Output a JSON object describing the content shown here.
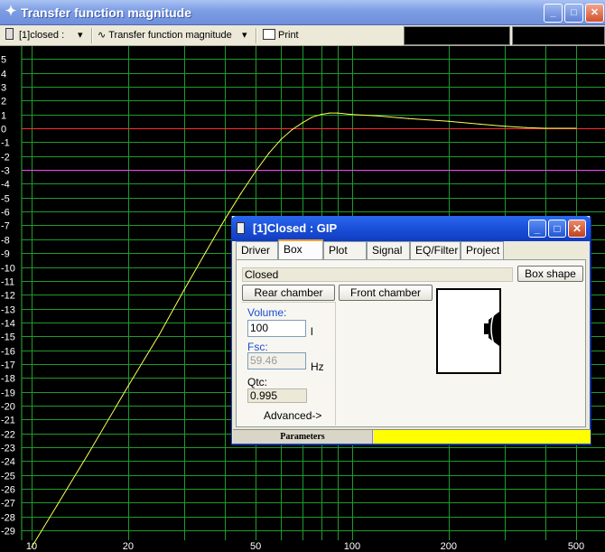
{
  "window": {
    "title": "Transfer function magnitude",
    "minimize_glyph": "_",
    "maximize_glyph": "□",
    "close_glyph": "✕"
  },
  "toolbar": {
    "project_select": "[1]closed :",
    "graph_select": "Transfer function magnitude",
    "print_label": "Print",
    "icons": [
      "speaker-icon",
      "waveform-icon",
      "printer-icon"
    ]
  },
  "plot": {
    "background": "#000000",
    "grid_color": "#1f9a2a",
    "curve_color": "#ffff55",
    "ref_line_0db_color": "#ff3030",
    "ref_line_minus3db_color": "#ff40ff",
    "y_ticks": [
      "5",
      "4",
      "3",
      "2",
      "1",
      "0",
      "-1",
      "-2",
      "-3",
      "-4",
      "-5",
      "-6",
      "-7",
      "-8",
      "-9",
      "-10",
      "-11",
      "-12",
      "-13",
      "-14",
      "-15",
      "-16",
      "-17",
      "-18",
      "-19",
      "-20",
      "-21",
      "-22",
      "-23",
      "-24",
      "-25",
      "-26",
      "-27",
      "-28",
      "-29"
    ],
    "x_ticks": [
      "10",
      "20",
      "50",
      "100",
      "200",
      "500"
    ]
  },
  "chart_data": {
    "type": "line",
    "x_scale": "log",
    "xlim": [
      10,
      500
    ],
    "ylim": [
      -30,
      5.5
    ],
    "reference_lines": [
      0,
      -3
    ],
    "series": [
      {
        "x": [
          10,
          12,
          15,
          20,
          25,
          30,
          35,
          40,
          45,
          50,
          55,
          60,
          65,
          70,
          75,
          80,
          85,
          90,
          100,
          120,
          150,
          200,
          250,
          300,
          350,
          400,
          450,
          500
        ],
        "y": [
          -30.2,
          -27.2,
          -23.5,
          -18.6,
          -14.9,
          -11.6,
          -8.9,
          -6.6,
          -4.7,
          -3.1,
          -1.8,
          -0.8,
          -0.1,
          0.4,
          0.8,
          1.0,
          1.1,
          1.1,
          1.0,
          0.9,
          0.7,
          0.5,
          0.3,
          0.15,
          0.05,
          0.0,
          0.0,
          0.0
        ]
      }
    ]
  },
  "dialog": {
    "title": "[1]Closed : GIP",
    "tabs": [
      "Driver",
      "Box",
      "Plot",
      "Signal",
      "EQ/Filter",
      "Project"
    ],
    "box_type": "Closed",
    "box_shape_button": "Box shape",
    "rear_chamber_button": "Rear chamber",
    "front_chamber_button": "Front chamber",
    "volume_label": "Volume:",
    "volume_value": "100",
    "volume_unit": "l",
    "fsc_label": "Fsc:",
    "fsc_value": "59.46",
    "fsc_unit": "Hz",
    "qtc_label": "Qtc:",
    "qtc_value": "0.995",
    "advanced_button": "Advanced->",
    "status_left": "Parameters",
    "status_right_color": "#ffff00"
  }
}
